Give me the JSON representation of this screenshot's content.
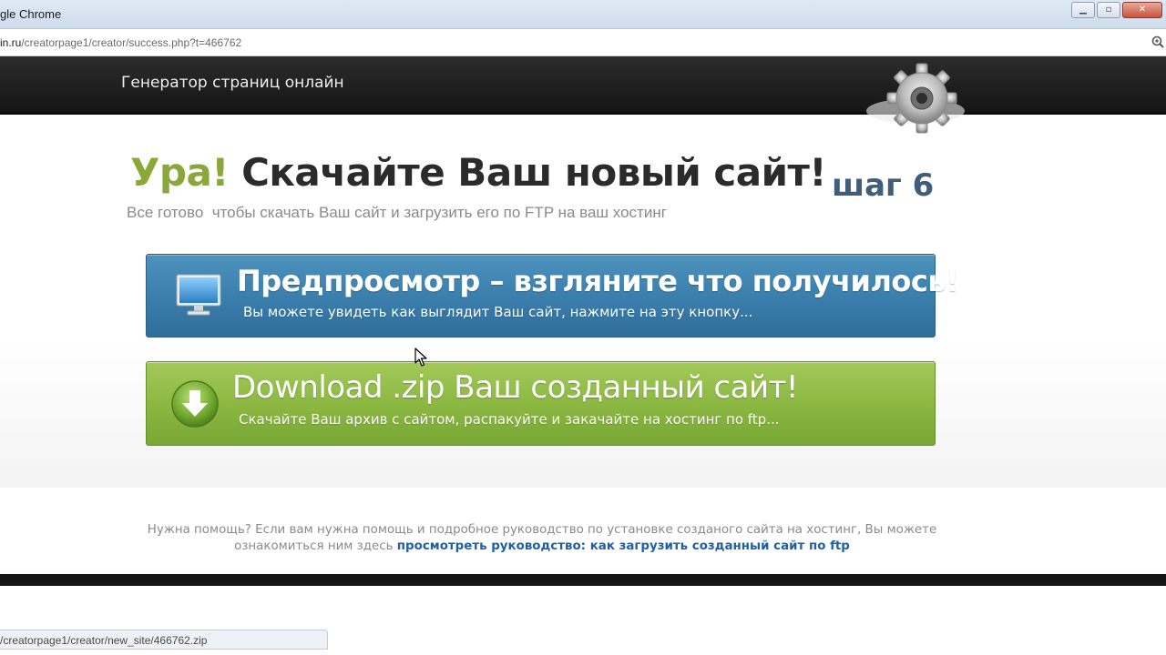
{
  "browser": {
    "title": "gle Chrome",
    "url_host": "in.ru",
    "url_path": "/creatorpage1/creator/success.php?t=466762",
    "window_buttons": [
      "▁",
      "▫",
      "✕"
    ],
    "status_url": "/creatorpage1/creator/new_site/466762.zip"
  },
  "site": {
    "logo_text": "Генератор страниц онлайн"
  },
  "main": {
    "headline_hooray": "Ура!",
    "headline_rest": "Скачайте Ваш новый сайт!",
    "subtitle": "Все готово  чтобы скачать Ваш сайт и загрузить его по FTP на ваш хостинг",
    "step": "шаг 6",
    "preview_button": {
      "title": "Предпросмотр – взгляните что получилось!",
      "subtitle": "Вы можете увидеть как выглядит Ваш сайт, нажмите на эту кнопку..."
    },
    "download_button": {
      "title": "Download .zip  Ваш созданный сайт!",
      "subtitle": "Скачайте Ваш архив с сайтом, распакуйте и закачайте на хостинг по ftp..."
    }
  },
  "help": {
    "text_line1": "Нужна помощь? Если вам нужна помощь и подробное руководство по установке созданого сайта на хостинг, Вы можете",
    "text_line2": "ознакомиться ним здесь ",
    "link": "просмотреть руководство: как загрузить созданный сайт по ftp"
  },
  "colors": {
    "accent_green": "#8aa83a",
    "step_blue": "#3f5e7a",
    "preview_blue": "#3b7fad",
    "download_green": "#8cb842",
    "link_blue": "#1f5fa6"
  },
  "icons": [
    "zoom-icon",
    "gear-icon",
    "monitor-icon",
    "download-arrow-icon",
    "cursor-icon"
  ]
}
